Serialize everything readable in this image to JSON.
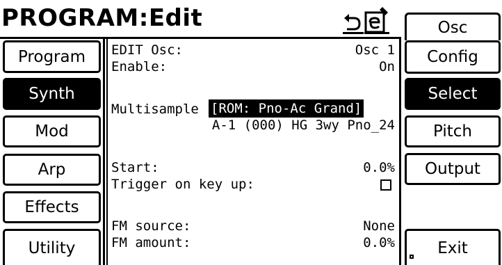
{
  "header": {
    "title": "PROGRAM:Edit",
    "icons": [
      "undo-arrow-icon",
      "edit-document-icon"
    ]
  },
  "left_tabs": [
    {
      "label": "Program",
      "active": false
    },
    {
      "label": "Synth",
      "active": true
    },
    {
      "label": "Mod",
      "active": false
    },
    {
      "label": "Arp",
      "active": false
    },
    {
      "label": "Effects",
      "active": false
    },
    {
      "label": "Utility",
      "active": false
    }
  ],
  "right_tabs": {
    "top": {
      "label": "Osc"
    },
    "items": [
      {
        "label": "Config",
        "active": false
      },
      {
        "label": "Select",
        "active": true
      },
      {
        "label": "Pitch",
        "active": false
      },
      {
        "label": "Output",
        "active": false
      }
    ],
    "exit": {
      "label": "Exit"
    }
  },
  "params": {
    "edit_osc": {
      "label": "EDIT Osc:",
      "value": "Osc 1"
    },
    "enable": {
      "label": "Enable:",
      "value": "On"
    },
    "multisample": {
      "label": "Multisample",
      "value": "[ROM: Pno-Ac Grand]",
      "sample": "A-1 (000) HG 3wy Pno_24"
    },
    "start": {
      "label": "Start:",
      "value": "0.0%"
    },
    "trigger": {
      "label": "Trigger on key up:",
      "checked": false
    },
    "fm_source": {
      "label": "FM source:",
      "value": "None"
    },
    "fm_amount": {
      "label": "FM amount:",
      "value": "0.0%"
    }
  },
  "colors": {
    "foreground": "#000000",
    "background": "#ffffff"
  }
}
